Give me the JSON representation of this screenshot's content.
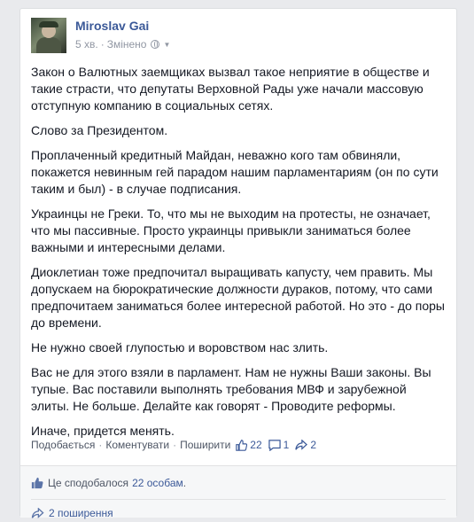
{
  "post": {
    "author": "Miroslav Gai",
    "time": "5 хв.",
    "edited": "Змінено",
    "paragraphs": [
      "Закон о Валютных заемщиках вызвал такое неприятие в обществе и такие страсти, что депутаты Верховной Рады уже начали массовую отступную компанию в социальных сетях.",
      "Слово за Президентом.",
      "Проплаченный кредитный Майдан, неважно кого там обвиняли, покажется невинным гей парадом нашим парламентариям (он по сути таким и был) - в случае подписания.",
      "Украинцы не Греки. То, что мы не выходим на протесты, не означает, что мы пассивные. Просто украинцы привыкли заниматься более важными и интересными делами.",
      "Диоклетиан тоже предпочитал выращивать капусту, чем править. Мы допускаем на бюрократические должности дураков, потому, что сами предпочитаем заниматься более интересной работой. Но это - до поры до времени.",
      "Не нужно своей глупостью и воровством нас злить.",
      "Вас не для этого взяли в парламент. Нам не нужны Ваши законы. Вы тупые. Вас поставили выполнять требования МВФ и зарубежной элиты. Не больше. Делайте как говорят - Проводите реформы.",
      "Иначе, придется менять."
    ]
  },
  "actions": {
    "like": "Подобається",
    "comment": "Коментувати",
    "share": "Поширити",
    "like_count": "22",
    "comment_count": "1",
    "share_count": "2"
  },
  "ufi": {
    "likes_prefix": "Це сподобалося",
    "likes_link": "22 особам",
    "likes_suffix": ".",
    "shares": "2 поширення"
  },
  "colors": {
    "link": "#3b5998",
    "muted": "#9197a3",
    "page_bg": "#e9eaed"
  }
}
